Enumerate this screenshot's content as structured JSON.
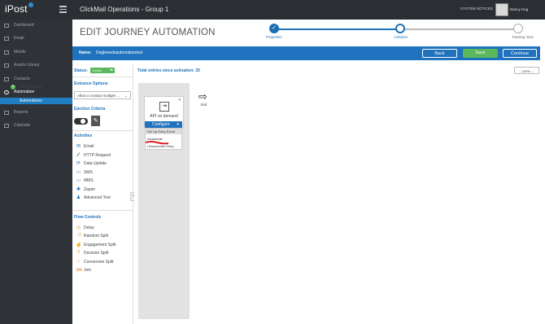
{
  "logo": "iPost",
  "app_title": "ClickMail Operations - Group 1",
  "notices": "SYSTEM NOTICES",
  "user_name": "Nancy Hug",
  "nav": {
    "items": [
      {
        "label": "Dashboard"
      },
      {
        "label": "Email"
      },
      {
        "label": "Mobile"
      },
      {
        "label": "Assets Library"
      },
      {
        "label": "Contacts"
      },
      {
        "label": "Automation"
      },
      {
        "label": "Reports"
      },
      {
        "label": "Calendar"
      }
    ],
    "sub_active": "Automations"
  },
  "page": {
    "title": "EDIT JOURNEY AUTOMATION",
    "steps": [
      {
        "label": "Properties",
        "state": "done"
      },
      {
        "label": "Activities",
        "state": "current"
      },
      {
        "label": "Tracking View",
        "state": "todo"
      }
    ]
  },
  "namebar": {
    "label": "Name:",
    "value": "Dogbreedsautomationtest",
    "back": "Back",
    "save": "Save",
    "continue": "Continue"
  },
  "left": {
    "status_label": "Status:",
    "status_value": "Active",
    "entrance_heading": "Entrance Options",
    "entrance_value": "Allow a contact multiple ...",
    "ejection_heading": "Ejection Criteria",
    "activities_heading": "Activities",
    "activities": [
      {
        "label": "Email",
        "icon": "envelope-icon"
      },
      {
        "label": "HTTP Request",
        "icon": "http-icon"
      },
      {
        "label": "Data Update",
        "icon": "refresh-icon"
      },
      {
        "label": "SMS",
        "icon": "sms-icon"
      },
      {
        "label": "MMS",
        "icon": "mms-icon"
      },
      {
        "label": "Zapier",
        "icon": "zapier-icon"
      },
      {
        "label": "Advanced Test",
        "icon": "person-icon"
      }
    ],
    "flow_heading": "Flow Controls",
    "flow": [
      {
        "label": "Delay",
        "icon": "clock-icon"
      },
      {
        "label": "Random Split",
        "icon": "shuffle-icon"
      },
      {
        "label": "Engagement Split",
        "icon": "engagement-icon"
      },
      {
        "label": "Decision Split",
        "icon": "question-icon"
      },
      {
        "label": "Conversion Split",
        "icon": "trophy-icon"
      },
      {
        "label": "Join",
        "icon": "join-icon"
      }
    ]
  },
  "canvas": {
    "title": "Total entries since activation: 20",
    "zoom": "100%",
    "entry_events": "Entry Events",
    "card_text": "API on demand",
    "configure": "Configure",
    "menu": [
      "Set Up Entry Event",
      "Deactivate",
      "Unsubscribe Entry"
    ],
    "exit_label": "Exit"
  },
  "colors": {
    "brand_blue": "#1f72bd",
    "save_green": "#5cb85c",
    "sidebar_dark": "#2f3338"
  }
}
